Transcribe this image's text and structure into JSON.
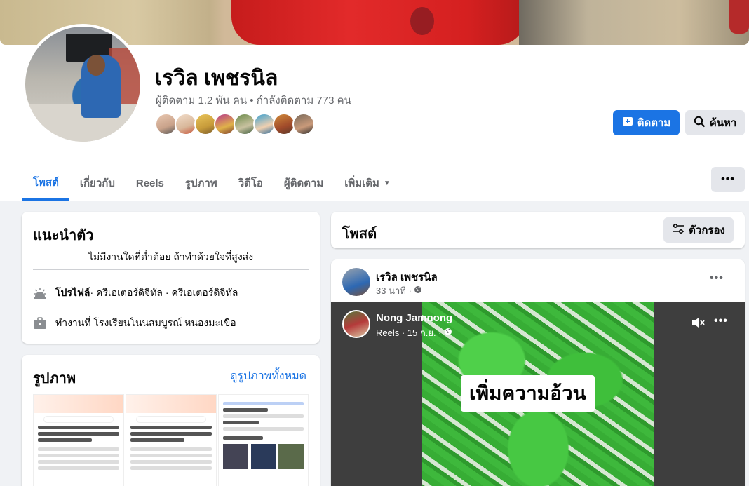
{
  "profile": {
    "name": "เรวิล เพชรนิล",
    "follow_stats": "ผู้ติดตาม 1.2 พัน คน • กำลังติดตาม 773 คน",
    "follow_button": "ติดตาม",
    "search_button": "ค้นหา"
  },
  "tabs": [
    {
      "label": "โพสต์"
    },
    {
      "label": "เกี่ยวกับ"
    },
    {
      "label": "Reels"
    },
    {
      "label": "รูปภาพ"
    },
    {
      "label": "วิดีโอ"
    },
    {
      "label": "ผู้ติดตาม"
    },
    {
      "label": "เพิ่มเติม"
    }
  ],
  "intro": {
    "title": "แนะนำตัว",
    "bio": "ไม่มีงานใดที่ต่ำต้อย ถ้าทำด้วยใจที่สูงส่ง",
    "profile_label": "โปรไฟล์",
    "profile_text": " · ครีเอเตอร์ดิจิทัล · ครีเอเตอร์ดิจิทัล",
    "work_text": "ทำงานที่ โรงเรียนโนนสมบูรณ์ หนองมะเขือ"
  },
  "photos": {
    "title": "รูปภาพ",
    "see_all": "ดูรูปภาพทั้งหมด"
  },
  "posts": {
    "title": "โพสต์",
    "filter_button": "ตัวกรอง"
  },
  "post": {
    "author": "เรวิล เพชรนิล",
    "time": "33 นาที ·",
    "reel_author": "Nong Jamnong",
    "reel_meta": "Reels · 15 ก.ย. ·",
    "reel_caption": "เพิ่มความอ้วน"
  },
  "colors": {
    "accent": "#1b74e4",
    "page_bg": "#f0f2f5",
    "secondary_button": "#e4e6eb"
  }
}
